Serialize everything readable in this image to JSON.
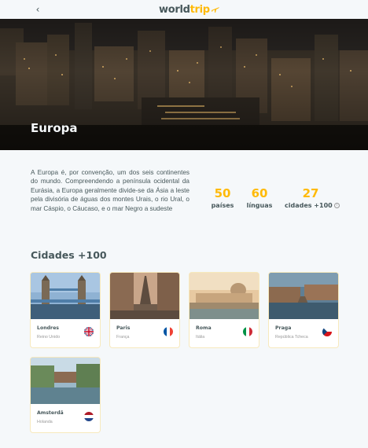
{
  "header": {
    "back_glyph": "‹",
    "logo_part1": "world",
    "logo_part2": "trip",
    "logo_icon": "airplane-icon"
  },
  "banner": {
    "title": "Europa"
  },
  "description": "A Europa é, por convenção, um dos seis continentes do mundo. Compreendendo a península ocidental da Eurásia, a Europa geralmente divide-se da Ásia a leste pela divisória de águas dos montes Urais, o rio Ural, o mar Cáspio, o Cáucaso, e o mar Negro a sudeste",
  "stats": [
    {
      "value": "50",
      "label": "países"
    },
    {
      "value": "60",
      "label": "línguas"
    },
    {
      "value": "27",
      "label": "cidades +100",
      "icon": "info-icon",
      "icon_glyph": "i"
    }
  ],
  "cities_section": {
    "title": "Cidades +100",
    "cards": [
      {
        "city": "Londres",
        "country": "Reino Unido",
        "flag": "uk-flag-icon"
      },
      {
        "city": "Paris",
        "country": "França",
        "flag": "france-flag-icon"
      },
      {
        "city": "Roma",
        "country": "Itália",
        "flag": "italy-flag-icon"
      },
      {
        "city": "Praga",
        "country": "República Tcheca",
        "flag": "czech-flag-icon"
      },
      {
        "city": "Amsterdã",
        "country": "Holanda",
        "flag": "netherlands-flag-icon"
      }
    ]
  },
  "colors": {
    "accent": "#ffba08",
    "text": "#47585b",
    "background": "#f5f8fa",
    "muted": "#999999"
  }
}
